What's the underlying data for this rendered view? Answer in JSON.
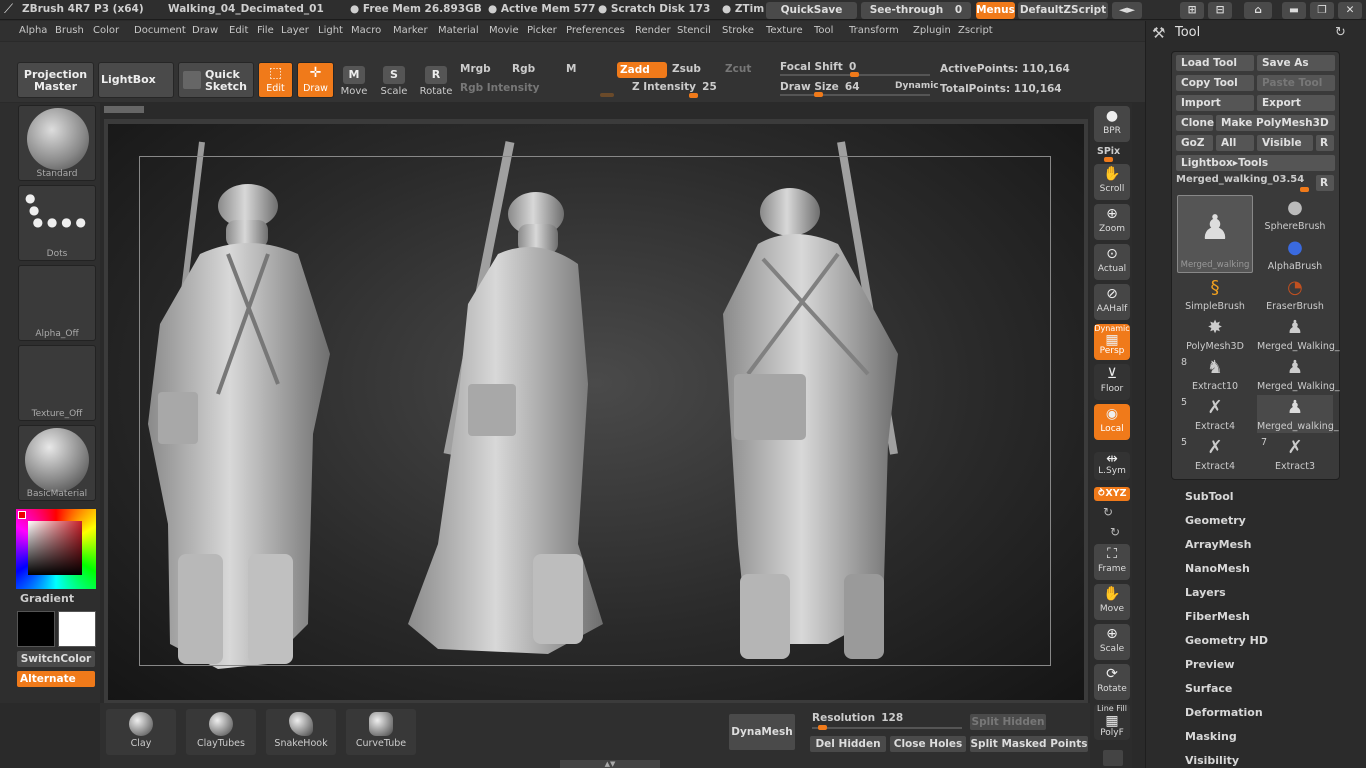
{
  "title": {
    "app": "ZBrush 4R7 P3 (x64)",
    "document": "Walking_04_Decimated_01",
    "free_mem": "● Free Mem 26.893GB",
    "active_mem": "● Active Mem 577",
    "scratch": "● Scratch Disk 173",
    "ztime": "● ZTim",
    "quicksave": "QuickSave",
    "seethrough": "See-through",
    "seethrough_value": "0",
    "menus": "Menus",
    "default_zscript": "DefaultZScript"
  },
  "menu": [
    "Alpha",
    "Brush",
    "Color",
    "Document",
    "Draw",
    "Edit",
    "File",
    "Layer",
    "Light",
    "Macro",
    "Marker",
    "Material",
    "Movie",
    "Picker",
    "Preferences",
    "Render",
    "Stencil",
    "Stroke",
    "Texture",
    "Tool",
    "Transform",
    "Zplugin",
    "Zscript"
  ],
  "toolbar": {
    "projection_master": "Projection Master",
    "lightbox": "LightBox",
    "quick_sketch": "Quick Sketch",
    "edit": "Edit",
    "draw": "Draw",
    "move": "Move",
    "scale": "Scale",
    "rotate": "Rotate",
    "mrgb": "Mrgb",
    "rgb": "Rgb",
    "m": "M",
    "rgb_intensity": "Rgb Intensity",
    "zadd": "Zadd",
    "zsub": "Zsub",
    "zcut": "Zcut",
    "z_intensity": "Z Intensity",
    "z_intensity_value": "25",
    "focal_shift": "Focal Shift",
    "focal_shift_value": "0",
    "draw_size": "Draw Size",
    "draw_size_value": "64",
    "dynamic": "Dynamic",
    "active_points": "ActivePoints: 110,164",
    "total_points": "TotalPoints: 110,164"
  },
  "left_shelf": {
    "standard": "Standard",
    "dots": "Dots",
    "alpha_off": "Alpha_Off",
    "texture_off": "Texture_Off",
    "basic_material": "BasicMaterial",
    "gradient": "Gradient",
    "switch_color": "SwitchColor",
    "alternate": "Alternate"
  },
  "right_shelf": {
    "bpr": "BPR",
    "spix": "SPix",
    "scroll": "Scroll",
    "zoom": "Zoom",
    "actual": "Actual",
    "aahalf": "AAHalf",
    "dynamic": "Dynamic",
    "persp": "Persp",
    "floor": "Floor",
    "local": "Local",
    "lsym": "L.Sym",
    "xyz": "⥁XYZ",
    "frame": "Frame",
    "move": "Move",
    "scale": "Scale",
    "rotate": "Rotate",
    "line_fill": "Line Fill",
    "polyf": "PolyF"
  },
  "tool_panel": {
    "title": "Tool",
    "load_tool": "Load Tool",
    "save_as": "Save As",
    "copy_tool": "Copy Tool",
    "paste_tool": "Paste Tool",
    "import": "Import",
    "export": "Export",
    "clone": "Clone",
    "make_polymesh": "Make PolyMesh3D",
    "goz": "GoZ",
    "all": "All",
    "visible": "Visible",
    "r": "R",
    "lightbox_tools": "Lightbox▸Tools",
    "current_tool": "Merged_walking_03.",
    "current_tool_value": "54",
    "tools": [
      {
        "label": "Merged_walking",
        "badge": ""
      },
      {
        "label": "SphereBrush",
        "badge": ""
      },
      {
        "label": "AlphaBrush",
        "badge": ""
      },
      {
        "label": "SimpleBrush",
        "badge": ""
      },
      {
        "label": "EraserBrush",
        "badge": ""
      },
      {
        "label": "PolyMesh3D",
        "badge": ""
      },
      {
        "label": "Merged_Walking_",
        "badge": ""
      },
      {
        "label": "Extract10",
        "badge": "8"
      },
      {
        "label": "Merged_Walking_",
        "badge": ""
      },
      {
        "label": "Extract4",
        "badge": "5"
      },
      {
        "label": "Merged_walking_",
        "badge": ""
      },
      {
        "label": "Extract4",
        "badge": "5"
      },
      {
        "label": "Extract3",
        "badge": "7"
      }
    ],
    "sections": [
      "SubTool",
      "Geometry",
      "ArrayMesh",
      "NanoMesh",
      "Layers",
      "FiberMesh",
      "Geometry HD",
      "Preview",
      "Surface",
      "Deformation",
      "Masking",
      "Visibility"
    ]
  },
  "bottom": {
    "brushes": [
      "Clay",
      "ClayTubes",
      "SnakeHook",
      "CurveTube"
    ],
    "dynamesh": "DynaMesh",
    "resolution": "Resolution",
    "resolution_value": "128",
    "split_hidden": "Split Hidden",
    "del_hidden": "Del Hidden",
    "close_holes": "Close Holes",
    "split_masked": "Split Masked Points"
  },
  "colors": {
    "accent": "#f07a1a",
    "main_color": "#000000",
    "secondary_color": "#ffffff"
  }
}
